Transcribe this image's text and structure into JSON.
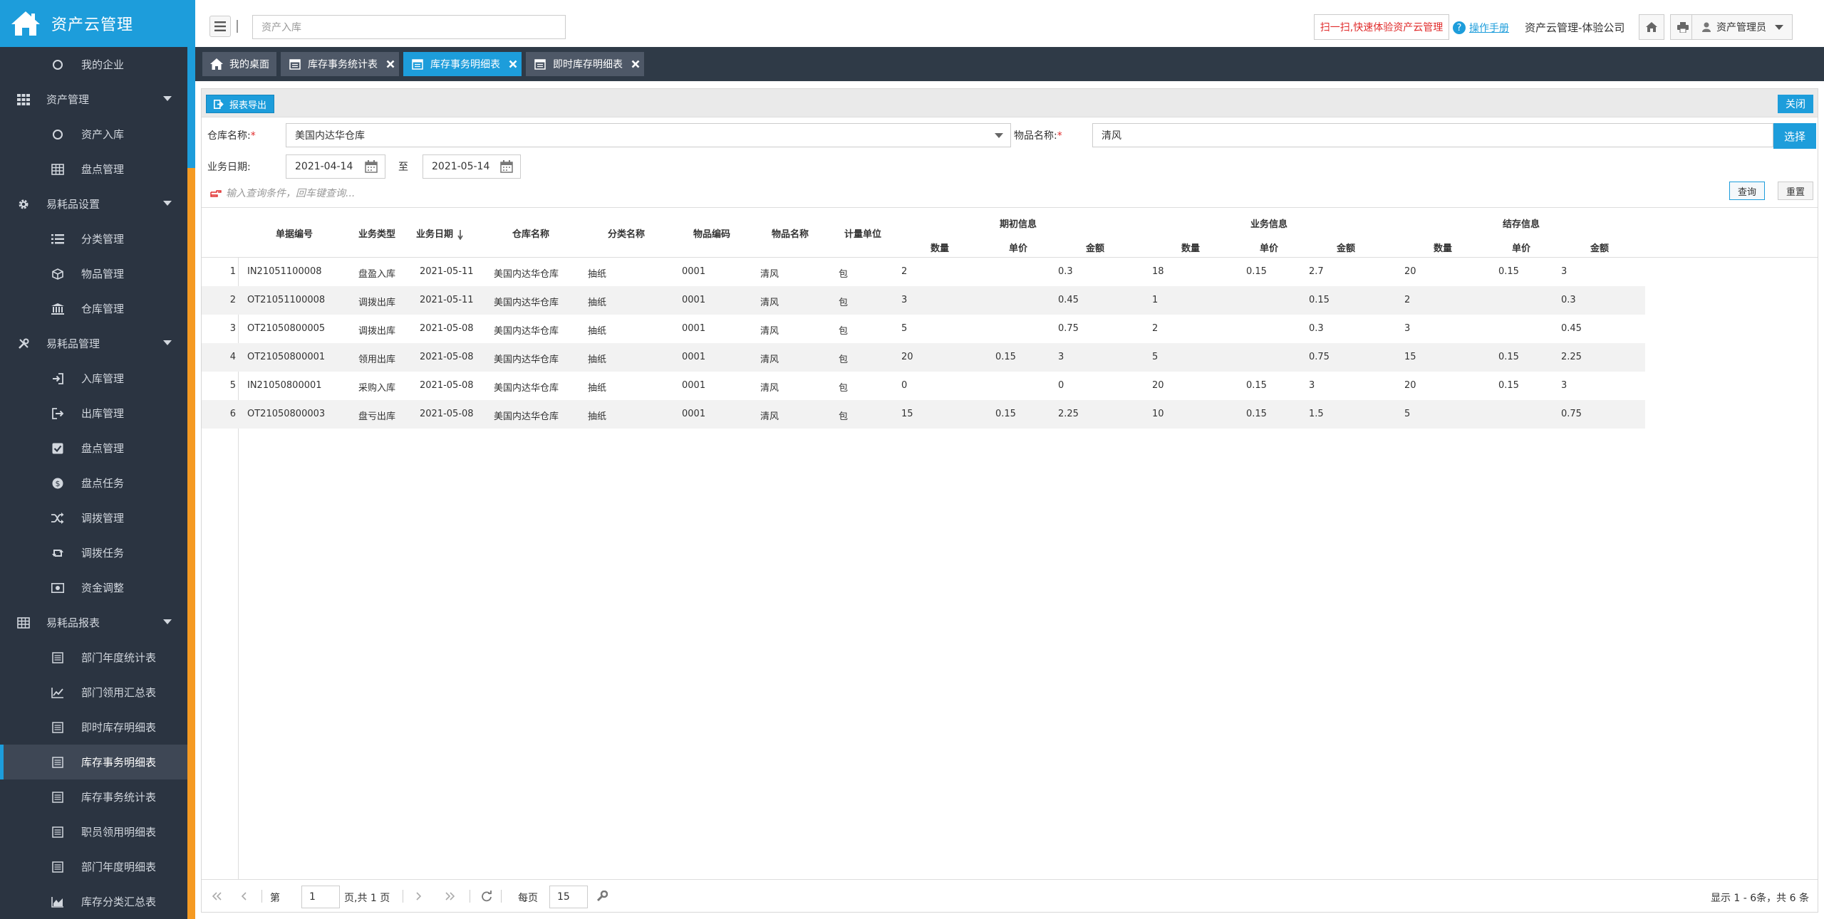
{
  "brand": {
    "title": "资产云管理"
  },
  "sidebar": {
    "items": [
      {
        "type": "sub",
        "label": "我的企业",
        "icon": "circle-icon"
      },
      {
        "type": "group",
        "label": "资产管理",
        "icon": "grid-icon"
      },
      {
        "type": "sub",
        "label": "资产入库",
        "icon": "circle-icon"
      },
      {
        "type": "sub",
        "label": "盘点管理",
        "icon": "table-icon"
      },
      {
        "type": "group",
        "label": "易耗品设置",
        "icon": "gear-icon"
      },
      {
        "type": "sub",
        "label": "分类管理",
        "icon": "list-icon"
      },
      {
        "type": "sub",
        "label": "物品管理",
        "icon": "cube-icon"
      },
      {
        "type": "sub",
        "label": "仓库管理",
        "icon": "bank-icon"
      },
      {
        "type": "group",
        "label": "易耗品管理",
        "icon": "tools-icon"
      },
      {
        "type": "sub",
        "label": "入库管理",
        "icon": "sign-in-icon"
      },
      {
        "type": "sub",
        "label": "出库管理",
        "icon": "sign-out-icon"
      },
      {
        "type": "sub",
        "label": "盘点管理",
        "icon": "check-square-icon"
      },
      {
        "type": "sub",
        "label": "盘点任务",
        "icon": "dollar-circle-icon"
      },
      {
        "type": "sub",
        "label": "调拨管理",
        "icon": "shuffle-icon"
      },
      {
        "type": "sub",
        "label": "调拨任务",
        "icon": "retweet-icon"
      },
      {
        "type": "sub",
        "label": "资金调整",
        "icon": "money-icon"
      },
      {
        "type": "group",
        "label": "易耗品报表",
        "icon": "table-icon"
      },
      {
        "type": "sub",
        "label": "部门年度统计表",
        "icon": "doc-icon"
      },
      {
        "type": "sub",
        "label": "部门领用汇总表",
        "icon": "line-chart-icon"
      },
      {
        "type": "sub",
        "label": "即时库存明细表",
        "icon": "doc-icon"
      },
      {
        "type": "sub",
        "label": "库存事务明细表",
        "icon": "doc-icon",
        "active": true
      },
      {
        "type": "sub",
        "label": "库存事务统计表",
        "icon": "doc-icon"
      },
      {
        "type": "sub",
        "label": "职员领用明细表",
        "icon": "doc-icon"
      },
      {
        "type": "sub",
        "label": "部门年度明细表",
        "icon": "doc-icon"
      },
      {
        "type": "sub",
        "label": "库存分类汇总表",
        "icon": "area-chart-icon"
      }
    ]
  },
  "header": {
    "search_value": "资产入库",
    "scan_button": "扫一扫,快速体验资产云管理",
    "manual_link": "操作手册",
    "company": "资产云管理-体验公司",
    "user": "资产管理员"
  },
  "tabs": [
    {
      "label": "我的桌面",
      "icon": "home-icon",
      "closable": false
    },
    {
      "label": "库存事务统计表",
      "icon": "calendar-icon",
      "closable": true
    },
    {
      "label": "库存事务明细表",
      "icon": "calendar-icon",
      "closable": true,
      "active": true
    },
    {
      "label": "即时库存明细表",
      "icon": "calendar-icon",
      "closable": true
    }
  ],
  "toolbar": {
    "export_label": "报表导出",
    "close_label": "关闭"
  },
  "filters": {
    "warehouse_label": "仓库名称:",
    "warehouse_value": "美国内达华仓库",
    "item_label": "物品名称:",
    "item_value": "清风",
    "pick_label": "选择",
    "date_label": "业务日期:",
    "date_from": "2021-04-14",
    "date_to_label": "至",
    "date_to": "2021-05-14",
    "hint": "输入查询条件，回车键查询...",
    "query_label": "查询",
    "reset_label": "重置"
  },
  "table": {
    "columns": [
      "单据编号",
      "业务类型",
      "业务日期",
      "仓库名称",
      "分类名称",
      "物品编码",
      "物品名称",
      "计量单位"
    ],
    "groups": [
      "期初信息",
      "业务信息",
      "结存信息"
    ],
    "sub_columns": [
      "数量",
      "单价",
      "金额"
    ],
    "rows": [
      {
        "n": "1",
        "cells": [
          "IN21051100008",
          "盘盈入库",
          "2021-05-11",
          "美国内达华仓库",
          "抽纸",
          "0001",
          "清风",
          "包",
          "2",
          "",
          "0.3",
          "18",
          "0.15",
          "2.7",
          "20",
          "0.15",
          "3"
        ]
      },
      {
        "n": "2",
        "cells": [
          "OT21051100008",
          "调拨出库",
          "2021-05-11",
          "美国内达华仓库",
          "抽纸",
          "0001",
          "清风",
          "包",
          "3",
          "",
          "0.45",
          "1",
          "",
          "0.15",
          "2",
          "",
          "0.3"
        ]
      },
      {
        "n": "3",
        "cells": [
          "OT21050800005",
          "调拨出库",
          "2021-05-08",
          "美国内达华仓库",
          "抽纸",
          "0001",
          "清风",
          "包",
          "5",
          "",
          "0.75",
          "2",
          "",
          "0.3",
          "3",
          "",
          "0.45"
        ]
      },
      {
        "n": "4",
        "cells": [
          "OT21050800001",
          "领用出库",
          "2021-05-08",
          "美国内达华仓库",
          "抽纸",
          "0001",
          "清风",
          "包",
          "20",
          "0.15",
          "3",
          "5",
          "",
          "0.75",
          "15",
          "0.15",
          "2.25"
        ]
      },
      {
        "n": "5",
        "cells": [
          "IN21050800001",
          "采购入库",
          "2021-05-08",
          "美国内达华仓库",
          "抽纸",
          "0001",
          "清风",
          "包",
          "0",
          "",
          "0",
          "20",
          "0.15",
          "3",
          "20",
          "0.15",
          "3"
        ]
      },
      {
        "n": "6",
        "cells": [
          "OT21050800003",
          "盘亏出库",
          "2021-05-08",
          "美国内达华仓库",
          "抽纸",
          "0001",
          "清风",
          "包",
          "15",
          "0.15",
          "2.25",
          "10",
          "0.15",
          "1.5",
          "5",
          "",
          "0.75"
        ]
      }
    ]
  },
  "pager": {
    "page_prefix": "第",
    "page_value": "1",
    "page_suffix": "页,共 1 页",
    "per_page_label": "每页",
    "per_page_value": "15",
    "info": "显示 1 - 6条，共 6 条"
  }
}
